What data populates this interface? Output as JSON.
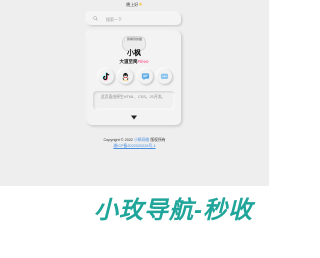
{
  "header": {
    "greeting": "晚上好",
    "greeting_icon": "sun-icon"
  },
  "search": {
    "placeholder": "搜索一下",
    "icon": "search-icon"
  },
  "profile": {
    "avatar_alt": "我看到的猫",
    "name": "小枫",
    "subtitle_main": "大道至简",
    "subtitle_accent": "Flevo"
  },
  "social": [
    {
      "name": "tiktok-icon",
      "color": "#111111"
    },
    {
      "name": "qq-icon",
      "color": "#111111"
    },
    {
      "name": "message-icon",
      "color": "#5aa9e6"
    },
    {
      "name": "chat-icon",
      "color": "#5aa9e6"
    }
  ],
  "description": {
    "text": "此页面由原生HTML、CSS，JS开发。"
  },
  "footer": {
    "copyright_prefix": "Copyright © 2022",
    "author": "小枫网络",
    "copyright_suffix": "版权所有",
    "icp": "湘ICP备2022020226号-1"
  },
  "watermark": {
    "text": "小玫导航-秒收"
  },
  "colors": {
    "accent": "#ff3b7f",
    "link": "#4a90e2",
    "watermark": "#20a59a"
  }
}
